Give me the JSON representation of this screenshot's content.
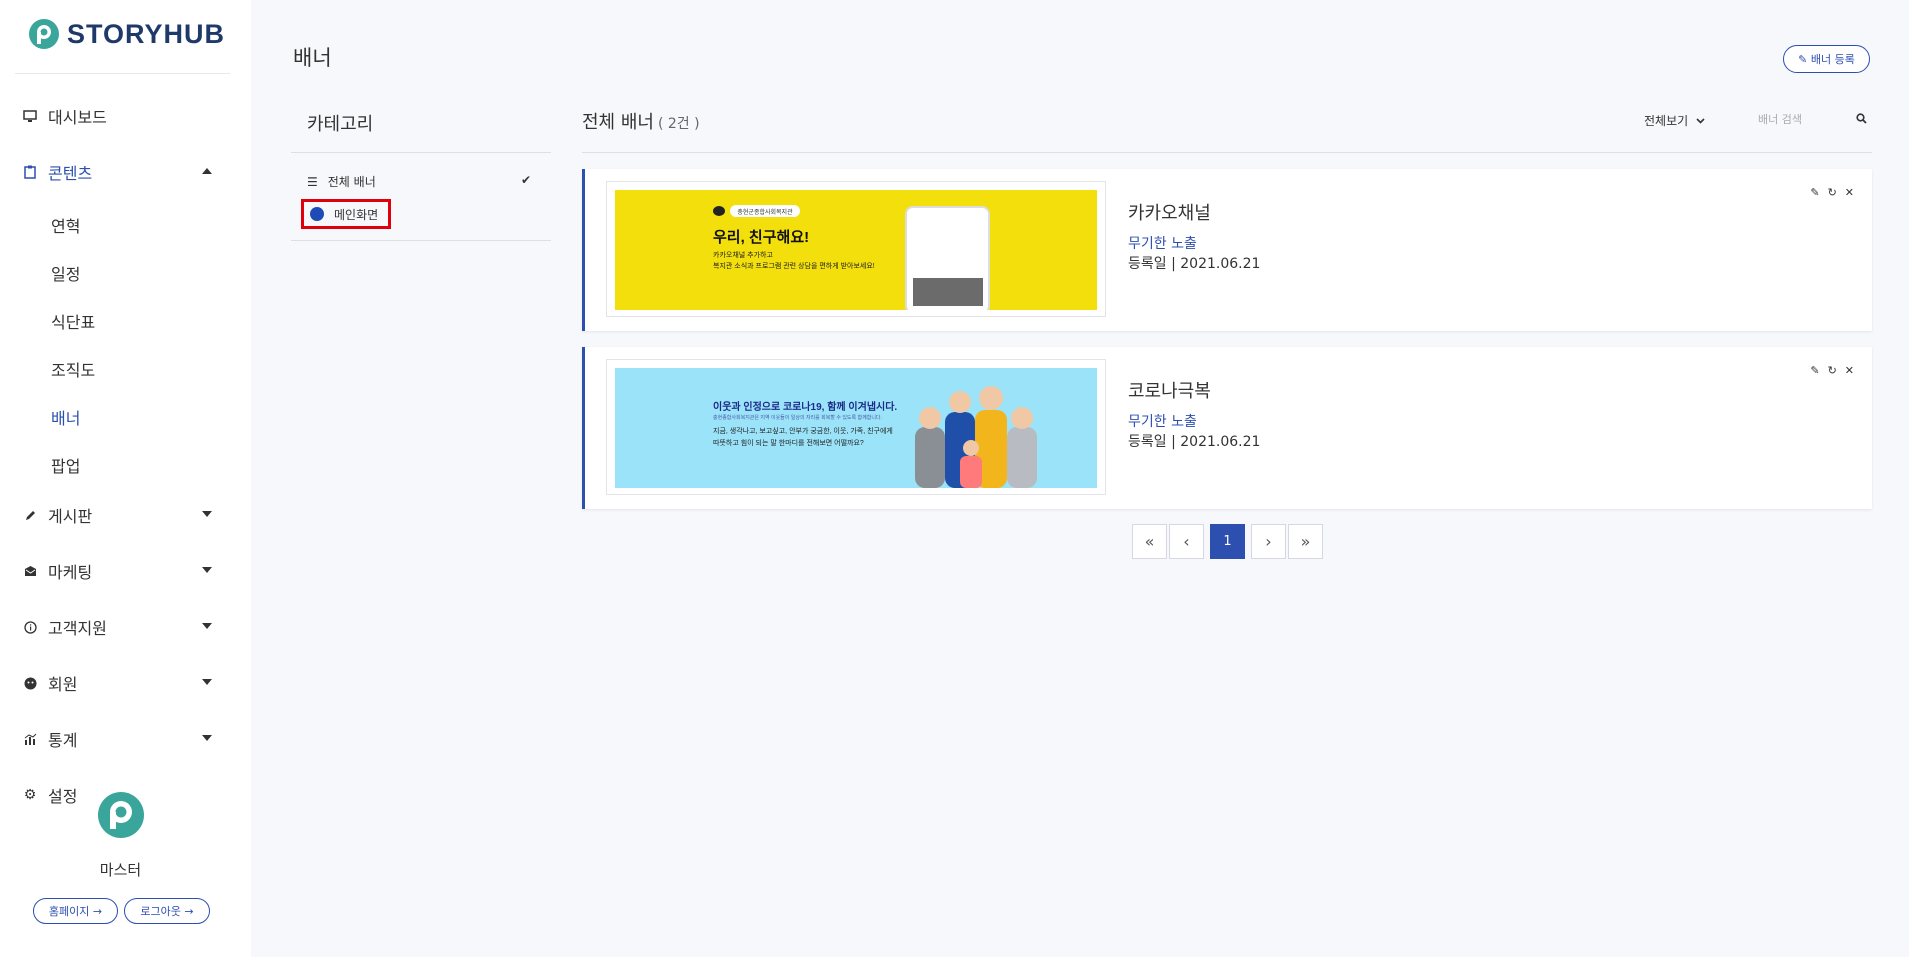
{
  "logo": {
    "text_a": "STORY",
    "text_b": "HUB"
  },
  "sidebar": {
    "items": [
      {
        "label": "대시보드",
        "icon": "monitor-icon"
      },
      {
        "label": "콘텐츠",
        "icon": "clipboard-icon",
        "expanded": true
      },
      {
        "label": "게시판",
        "icon": "pencil-icon"
      },
      {
        "label": "마케팅",
        "icon": "mail-icon"
      },
      {
        "label": "고객지원",
        "icon": "info-icon"
      },
      {
        "label": "회원",
        "icon": "user-icon"
      },
      {
        "label": "통계",
        "icon": "chart-icon"
      },
      {
        "label": "설정",
        "icon": "gear-icon"
      }
    ],
    "sub_items": [
      "연혁",
      "일정",
      "식단표",
      "조직도",
      "배너",
      "팝업"
    ],
    "active_sub": "배너"
  },
  "profile": {
    "name": "마스터",
    "homepage_btn": "홈페이지 →",
    "logout_btn": "로그아웃 →"
  },
  "page": {
    "title": "배너",
    "register_btn": "✎ 배너 등록"
  },
  "category": {
    "title": "카테고리",
    "all_label": "전체 배너",
    "main_label": "메인화면"
  },
  "list": {
    "title": "전체 배너",
    "count": "( 2건 )",
    "filter_label": "전체보기",
    "search_placeholder": "배너 검색"
  },
  "banners": [
    {
      "name": "카카오채널",
      "exposure": "무기한 노출",
      "date": "등록일 | 2021.06.21",
      "art": {
        "pill": "충현군종합사회복지관",
        "headline": "우리, 친구해요!",
        "line1": "카카오채널 추가하고",
        "line2": "복지관 소식과 프로그램 관련 상담을 편하게 받아보세요!"
      }
    },
    {
      "name": "코로나극복",
      "exposure": "무기한 노출",
      "date": "등록일 | 2021.06.21",
      "art": {
        "headline": "이웃과 인정으로 코로나19, 함께 이겨냅시다.",
        "sub": "충현종합사회복지관은 지역 이웃들이 일상의 자리를 회복할 수 있도록 함께합니다.",
        "line1": "지금, 생각나고, 보고싶고, 안부가 궁금한, 이웃, 가족, 친구에게",
        "line2": "따뜻하고 힘이 되는 말 한마디를 전해보면 어떨까요?"
      }
    }
  ],
  "pagination": {
    "current": "1"
  },
  "colors": {
    "accent": "#2c4fb0",
    "highlight": "#e0000b",
    "kakao": "#f2df0c",
    "corona": "#9be3f8"
  }
}
